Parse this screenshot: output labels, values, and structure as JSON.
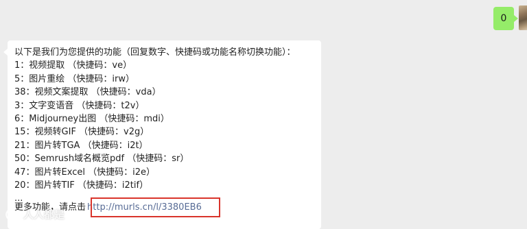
{
  "sent_message": {
    "text": "0"
  },
  "received_message": {
    "intro": "以下是我们为您提供的功能（回复数字、快捷码或功能名称切换功能）：",
    "items": [
      "1：视频提取 （快捷码：ve）",
      "5：图片重绘 （快捷码：irw）",
      "38：视频文案提取 （快捷码：vda）",
      "3：文字变语音 （快捷码：t2v）",
      "6：Midjourney出图 （快捷码：mdi）",
      "15：视频转GIF （快捷码：v2g）",
      "21：图片转TGA （快捷码：i2t）",
      "50：Semrush域名概览pdf （快捷码：sr）",
      "47：图片转Excel （快捷码：i2e）",
      "20：图片转TIF （快捷码：i2tif）"
    ],
    "ellipsis": "...",
    "more_prefix": "更多功能，请点击",
    "more_link": "http://murls.cn/l/3380EB6"
  },
  "watermark": {
    "text": "人人都是"
  },
  "colors": {
    "background": "#ededed",
    "sent_bubble": "#95ec69",
    "received_bubble": "#ffffff",
    "link": "#576b95",
    "highlight": "#d9342b"
  }
}
